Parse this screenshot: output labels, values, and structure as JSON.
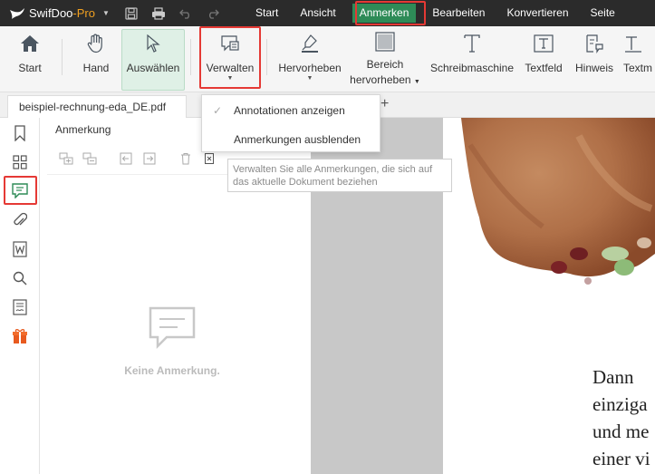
{
  "app": {
    "name": "SwifDoo",
    "name_suffix": "-Pro"
  },
  "menu": {
    "items": [
      "Start",
      "Ansicht",
      "Anmerken",
      "Bearbeiten",
      "Konvertieren",
      "Seite"
    ],
    "active": "Anmerken"
  },
  "ribbon": {
    "start": "Start",
    "hand": "Hand",
    "select": "Auswählen",
    "manage": "Verwalten",
    "highlight": "Hervorheben",
    "area_highlight_1": "Bereich",
    "area_highlight_2": "hervorheben",
    "typewriter": "Schreibmaschine",
    "textfield": "Textfeld",
    "note": "Hinweis",
    "textmark": "Textm"
  },
  "tab": {
    "filename": "beispiel-rechnung-eda_DE.pdf"
  },
  "dropdown": {
    "show": "Annotationen anzeigen",
    "hide": "Anmerkungen ausblenden"
  },
  "tooltip": {
    "line1": "Verwalten Sie alle Anmerkungen, die sich auf",
    "line2": "das aktuelle Dokument beziehen"
  },
  "panel": {
    "title": "Anmerkung",
    "empty": "Keine Anmerkung."
  },
  "document": {
    "lines": [
      "Dann",
      "einziga",
      "und me",
      "einer vi"
    ]
  },
  "colors": {
    "accent": "#2e8b57",
    "highlight": "#e53935",
    "titlebar": "#2b2b2b"
  }
}
